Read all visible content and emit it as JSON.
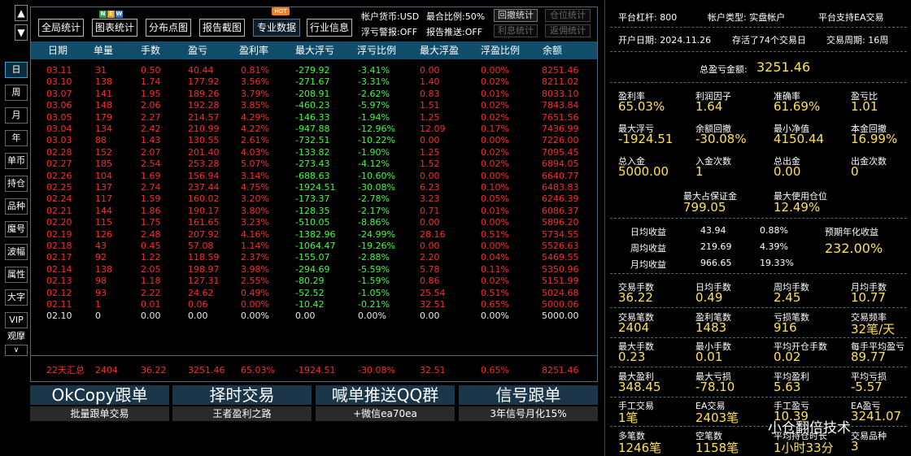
{
  "left_nav": {
    "arrow_up": "▲",
    "arrow_down": "▼",
    "items": [
      "日",
      "周",
      "月",
      "年",
      "单币",
      "持仓",
      "品种",
      "魔号",
      "波幅",
      "属性",
      "大字",
      "VIP",
      "观摩"
    ],
    "more": "∨"
  },
  "toolbar": {
    "buttons": [
      "全局统计",
      "图表统计",
      "分布点图",
      "报告截图",
      "专业数据",
      "行业信息"
    ],
    "new_badge": [
      "N",
      "E",
      "W"
    ],
    "hot_badge": "HOT",
    "info": {
      "currency": "帐户货币:USD",
      "ratio": "最合比例:50%",
      "float_warn": "浮亏警报:OFF",
      "report_push": "报告推送:OFF"
    },
    "small_buttons": [
      "回撤统计",
      "仓位统计",
      "利息统计",
      "返佣统计"
    ]
  },
  "table": {
    "headers": [
      "日期",
      "单量",
      "手数",
      "盈亏",
      "盈利率",
      "最大浮亏",
      "浮亏比例",
      "最大浮盈",
      "浮盈比例",
      "余额"
    ],
    "rows": [
      [
        "03.11",
        "31",
        "0.50",
        "40.44",
        "0.81%",
        "-279.92",
        "-3.41%",
        "0.00",
        "0.00%",
        "8251.46"
      ],
      [
        "03.10",
        "138",
        "1.74",
        "177.92",
        "3.56%",
        "-271.67",
        "-3.31%",
        "1.40",
        "0.02%",
        "8211.02"
      ],
      [
        "03.07",
        "141",
        "1.95",
        "189.26",
        "3.79%",
        "-208.91",
        "-2.62%",
        "0.83",
        "0.01%",
        "8033.10"
      ],
      [
        "03.06",
        "148",
        "2.06",
        "192.28",
        "3.85%",
        "-460.23",
        "-5.97%",
        "1.51",
        "0.02%",
        "7843.84"
      ],
      [
        "03.05",
        "179",
        "2.27",
        "214.57",
        "4.29%",
        "-146.33",
        "-1.94%",
        "1.25",
        "0.02%",
        "7651.56"
      ],
      [
        "03.04",
        "134",
        "2.42",
        "210.99",
        "4.22%",
        "-947.88",
        "-12.96%",
        "12.09",
        "0.17%",
        "7436.99"
      ],
      [
        "03.03",
        "88",
        "1.43",
        "130.55",
        "2.61%",
        "-732.51",
        "-10.22%",
        "0.00",
        "0.00%",
        "7226.00"
      ],
      [
        "02.28",
        "152",
        "2.07",
        "201.40",
        "4.03%",
        "-133.82",
        "-1.90%",
        "1.25",
        "0.02%",
        "7095.45"
      ],
      [
        "02.27",
        "185",
        "2.54",
        "253.28",
        "5.07%",
        "-273.43",
        "-4.12%",
        "1.52",
        "0.02%",
        "6894.05"
      ],
      [
        "02.26",
        "104",
        "1.69",
        "156.94",
        "3.14%",
        "-688.63",
        "-10.60%",
        "0.00",
        "0.00%",
        "6640.77"
      ],
      [
        "02.25",
        "137",
        "2.74",
        "237.44",
        "4.75%",
        "-1924.51",
        "-30.08%",
        "6.23",
        "0.10%",
        "6483.83"
      ],
      [
        "02.24",
        "117",
        "1.59",
        "160.02",
        "3.20%",
        "-173.37",
        "-2.78%",
        "3.23",
        "0.05%",
        "6246.39"
      ],
      [
        "02.21",
        "144",
        "1.86",
        "190.17",
        "3.80%",
        "-128.35",
        "-2.17%",
        "0.71",
        "0.01%",
        "6086.37"
      ],
      [
        "02.20",
        "115",
        "1.75",
        "161.65",
        "3.23%",
        "-510.05",
        "-8.86%",
        "0.00",
        "0.00%",
        "5896.20"
      ],
      [
        "02.19",
        "126",
        "2.48",
        "207.92",
        "4.16%",
        "-1382.96",
        "-24.99%",
        "28.16",
        "0.51%",
        "5734.55"
      ],
      [
        "02.18",
        "43",
        "0.45",
        "57.08",
        "1.14%",
        "-1064.47",
        "-19.26%",
        "0.00",
        "0.00%",
        "5526.63"
      ],
      [
        "02.17",
        "92",
        "1.22",
        "118.59",
        "2.37%",
        "-155.07",
        "-2.88%",
        "2.20",
        "0.04%",
        "5469.55"
      ],
      [
        "02.14",
        "138",
        "2.05",
        "198.97",
        "3.98%",
        "-294.69",
        "-5.59%",
        "5.78",
        "0.11%",
        "5350.96"
      ],
      [
        "02.13",
        "98",
        "1.18",
        "127.31",
        "2.55%",
        "-80.29",
        "-1.59%",
        "0.86",
        "0.02%",
        "5151.99"
      ],
      [
        "02.12",
        "93",
        "2.22",
        "24.62",
        "0.49%",
        "-52.52",
        "-1.05%",
        "25.54",
        "0.51%",
        "5024.68"
      ],
      [
        "02.11",
        "1",
        "0.01",
        "0.06",
        "0.00%",
        "-10.42",
        "-0.21%",
        "32.51",
        "0.65%",
        "5000.06"
      ],
      [
        "02.10",
        "0",
        "0.00",
        "0.00",
        "0.00%",
        "0.00",
        "0.00%",
        "0.00",
        "0.00%",
        "5000.00"
      ]
    ],
    "summary": [
      "22天汇总",
      "2404",
      "36.22",
      "3251.46",
      "65.03%",
      "-1924.51",
      "-30.08%",
      "32.51",
      "0.65%",
      "8251.46"
    ]
  },
  "banners": [
    {
      "title": "OkCopy跟单",
      "sub": "批量跟单交易"
    },
    {
      "title": "择时交易",
      "sub": "王者盈利之路"
    },
    {
      "title": "喊单推送QQ群",
      "sub": "+微信ea70ea"
    },
    {
      "title": "信号跟单",
      "sub": "3年信号月化15%"
    }
  ],
  "right_panel": {
    "row1": [
      "平台杠杆: 800",
      "帐户类型: 实盘帐户",
      "平台支持EA交易"
    ],
    "row2": [
      "开户日期: 2024.11.26",
      "存活了74个交易日",
      "交易周期: 16周"
    ],
    "total_label": "总盈亏金额:",
    "total_value": "3251.46",
    "stats1": [
      {
        "l": "盈利率",
        "v": "65.03%"
      },
      {
        "l": "利润因子",
        "v": "1.64"
      },
      {
        "l": "准确率",
        "v": "61.69%"
      },
      {
        "l": "盈亏比",
        "v": "1.01"
      },
      {
        "l": "最大浮亏",
        "v": "-1924.51"
      },
      {
        "l": "余额回撤",
        "v": "-30.08%"
      },
      {
        "l": "最小净值",
        "v": "4150.44"
      },
      {
        "l": "本金回撤",
        "v": "16.99%"
      },
      {
        "l": "总入金",
        "v": "5000.00"
      },
      {
        "l": "入金次数",
        "v": "1"
      },
      {
        "l": "总出金",
        "v": "0.00"
      },
      {
        "l": "出金次数",
        "v": "0"
      }
    ],
    "margin": [
      {
        "l": "最大占保证金",
        "v": "799.05"
      },
      {
        "l": "最大使用仓位",
        "v": "12.49%"
      }
    ],
    "avg": [
      {
        "l": "日均收益",
        "a": "43.94",
        "p": "0.88%"
      },
      {
        "l": "周均收益",
        "a": "219.69",
        "p": "4.39%"
      },
      {
        "l": "月均收益",
        "a": "966.65",
        "p": "19.33%"
      }
    ],
    "annual_label": "预期年化收益",
    "annual_value": "232.00%",
    "stats2": [
      {
        "l": "交易手数",
        "v": "36.22"
      },
      {
        "l": "日均手数",
        "v": "0.49"
      },
      {
        "l": "周均手数",
        "v": "2.45"
      },
      {
        "l": "月均手数",
        "v": "10.77"
      },
      {
        "l": "交易笔数",
        "v": "2404"
      },
      {
        "l": "盈利笔数",
        "v": "1483"
      },
      {
        "l": "亏损笔数",
        "v": "916"
      },
      {
        "l": "交易频率",
        "v": "32笔/天"
      },
      {
        "l": "最大手数",
        "v": "0.23"
      },
      {
        "l": "最小手数",
        "v": "0.01"
      },
      {
        "l": "平均开仓手数",
        "v": "0.02"
      },
      {
        "l": "每手平均盈亏",
        "v": "89.77"
      },
      {
        "l": "最大盈利",
        "v": "348.45"
      },
      {
        "l": "最大亏损",
        "v": "-78.10"
      },
      {
        "l": "平均盈利",
        "v": "5.63"
      },
      {
        "l": "平均亏损",
        "v": "-5.57"
      },
      {
        "l": "手工交易",
        "v": "1笔"
      },
      {
        "l": "EA交易",
        "v": "2403笔"
      },
      {
        "l": "手工盈亏",
        "v": "10.39"
      },
      {
        "l": "EA盈亏",
        "v": "3241.07"
      },
      {
        "l": "多笔数",
        "v": "1246笔"
      },
      {
        "l": "空笔数",
        "v": "1158笔"
      },
      {
        "l": "平均持仓时长",
        "v": "1小时33分"
      },
      {
        "l": "交易品种",
        "v": "3"
      }
    ],
    "watermark": "小仓翻倍技术"
  },
  "colors": {
    "profit": "#ff2a2a",
    "loss": "#3cff3c",
    "neutral": "#e8e8e8",
    "header": "#0f4d6b",
    "accent": "#ffe14a"
  }
}
